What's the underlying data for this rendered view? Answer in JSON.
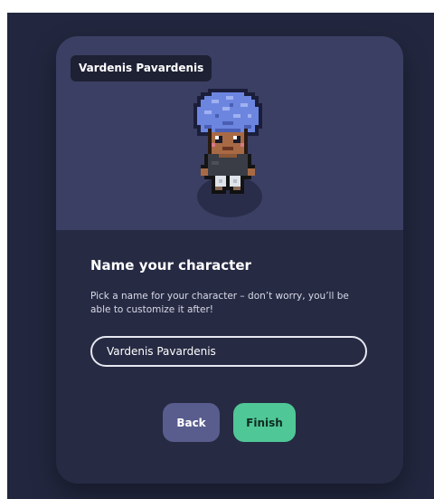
{
  "preview": {
    "name_tag": "Vardenis Pavardenis",
    "avatar_icon": "pixel-character-avatar"
  },
  "form": {
    "heading": "Name your character",
    "description": "Pick a name for your character – don’t worry, you’ll be able to customize it after!",
    "name_input_value": "Vardenis Pavardenis"
  },
  "buttons": {
    "back_label": "Back",
    "finish_label": "Finish"
  },
  "colors": {
    "backdrop": "#22273f",
    "card_bottom": "#262a43",
    "preview_bg": "#3b3f63",
    "back_button": "#585d8d",
    "finish_button": "#4fc796"
  }
}
